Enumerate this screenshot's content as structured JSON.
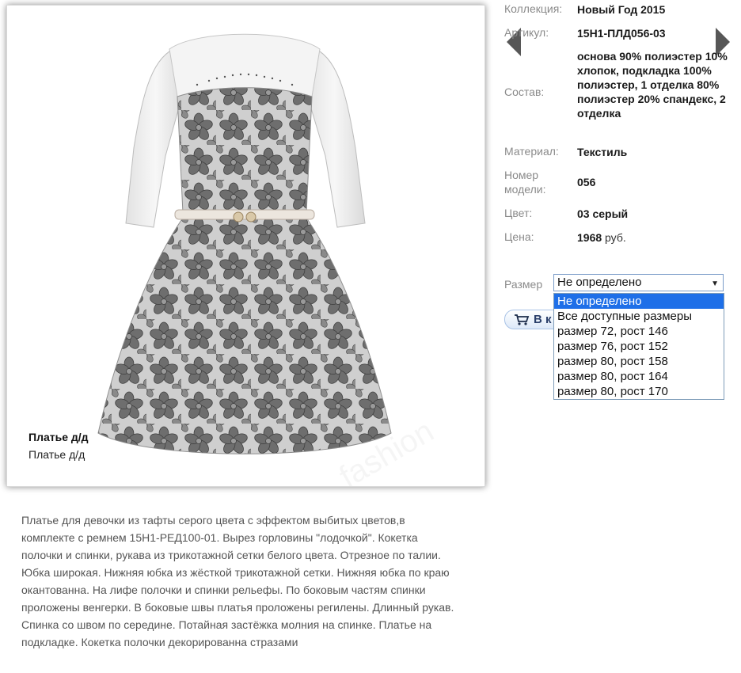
{
  "product": {
    "caption_title": "Платье д/д",
    "caption_subtitle": "Платье д/д",
    "watermark_text": "fashion"
  },
  "properties": {
    "collection_label": "Коллекция:",
    "collection_value": "Новый Год 2015",
    "article_label": "Артикул:",
    "article_value": "15Н1-ПЛД056-03",
    "composition_label": "Состав:",
    "composition_value": "основа 90% полиэстер 10% хлопок, подкладка 100% полиэстер, 1 отделка 80% полиэстер 20% спандекс, 2 отделка",
    "material_label": "Материал:",
    "material_value": "Текстиль",
    "model_label_line1": "Номер",
    "model_label_line2": "модели:",
    "model_value": "056",
    "color_label": "Цвет:",
    "color_value": "03 серый",
    "price_label": "Цена:",
    "price_value": "1968",
    "price_unit": "руб."
  },
  "size": {
    "label": "Размер",
    "selected": "Не определено",
    "options": [
      "Не определено",
      "Все доступные размеры",
      "размер 72, рост 146",
      "размер 76, рост 152",
      "размер 80, рост 158",
      "размер 80, рост 164",
      "размер 80, рост 170"
    ]
  },
  "cart": {
    "label_visible": "В к",
    "icon": "cart-icon"
  },
  "description": "Платье для девочки из тафты серого цвета с эффектом выбитых цветов,в комплекте с ремнем 15Н1-РЕД100-01. Вырез горловины \"лодочкой\". Кокетка полочки и спинки, рукава из трикотажной сетки белого цвета. Отрезное по талии. Юбка широкая. Нижняя юбка из жёсткой трикотажной сетки. Нижняя юбка по краю окантованна. На лифе полочки и спинки рельефы. По боковым частям спинки проложены венгерки. В боковые швы платья проложены регилены. Длинный рукав. Спинка со швом по середине. Потайная застёжка молния на спинке. Платье на подкладке. Кокетка полочки декорированна стразами",
  "colors": {
    "dropdown_selected": "#1e6fe8",
    "label_gray": "#8a8a8a",
    "description_text": "#555555"
  }
}
